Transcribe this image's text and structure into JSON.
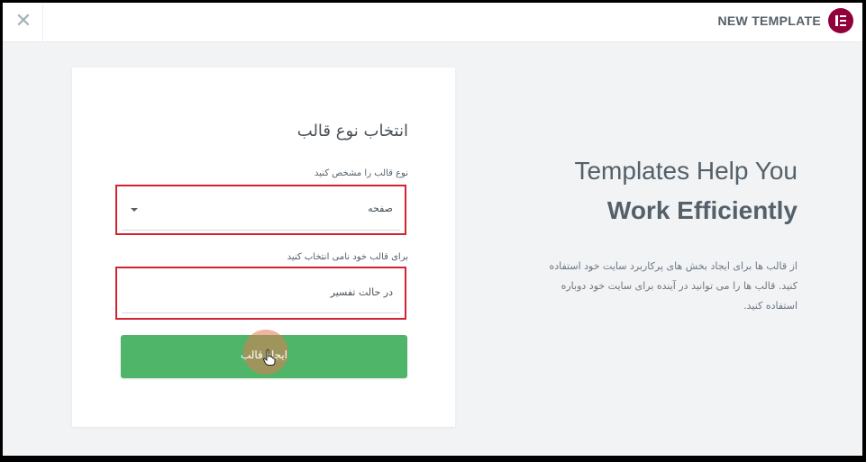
{
  "header": {
    "close_label": "✕",
    "title": "NEW TEMPLATE",
    "brand_color": "#92003b"
  },
  "form": {
    "title": "انتخاب نوع قالب",
    "type_label": "نوع قالب را مشخص کنید",
    "type_value": "صفحه",
    "name_label": "برای قالب خود نامی انتخاب کنید",
    "name_value": "در حالت تفسیر",
    "submit_label": "ایجاد قالب",
    "submit_color": "#4fb568",
    "highlight_color": "#d3232e"
  },
  "promo": {
    "heading_line1": "Templates Help You",
    "heading_line2": "Work Efficiently",
    "description": "از قالب ها برای ایجاد بخش های پرکاربرد سایت خود استفاده کنید. قالب ها را می توانید در آینده برای سایت خود دوباره استفاده کنید."
  }
}
